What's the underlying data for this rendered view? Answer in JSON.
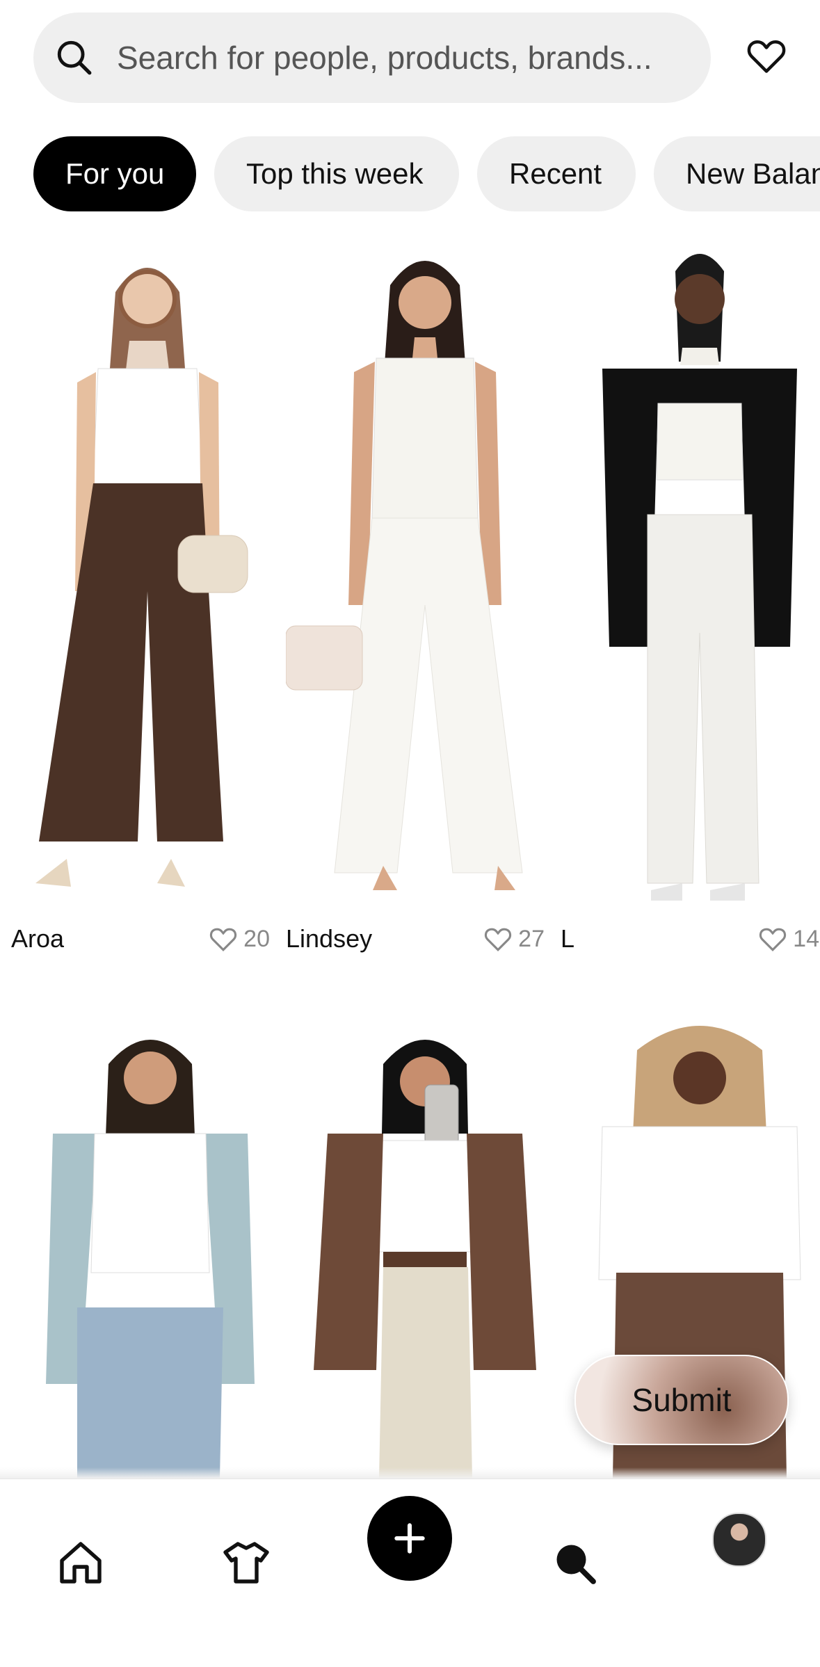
{
  "search": {
    "placeholder": "Search for people, products, brands..."
  },
  "chips": [
    "For you",
    "Top this week",
    "Recent",
    "New Balance"
  ],
  "grid": [
    {
      "name": "Aroa",
      "likes": "20",
      "top_color": "#ffffff",
      "bottom_color": "#4b3226",
      "layer_color": ""
    },
    {
      "name": "Lindsey",
      "likes": "27",
      "top_color": "#f5f4ef",
      "bottom_color": "#f7f6f2",
      "layer_color": ""
    },
    {
      "name": "L",
      "likes": "14",
      "top_color": "#f5f4ef",
      "bottom_color": "#f0efeb",
      "layer_color": "#111111"
    },
    {
      "name": "",
      "likes": "",
      "top_color": "#ffffff",
      "bottom_color": "#9bb3c9",
      "layer_color": "#a9c2c9"
    },
    {
      "name": "",
      "likes": "",
      "top_color": "#ffffff",
      "bottom_color": "#e3dccb",
      "layer_color": "#6e4a38"
    },
    {
      "name": "",
      "likes": "",
      "top_color": "#ffffff",
      "bottom_color": "#6b4a3a",
      "layer_color": ""
    }
  ],
  "submit_label": "Submit",
  "nav": {
    "items": [
      "home-icon",
      "shirt-icon",
      "plus-icon",
      "search-icon",
      "avatar"
    ]
  }
}
